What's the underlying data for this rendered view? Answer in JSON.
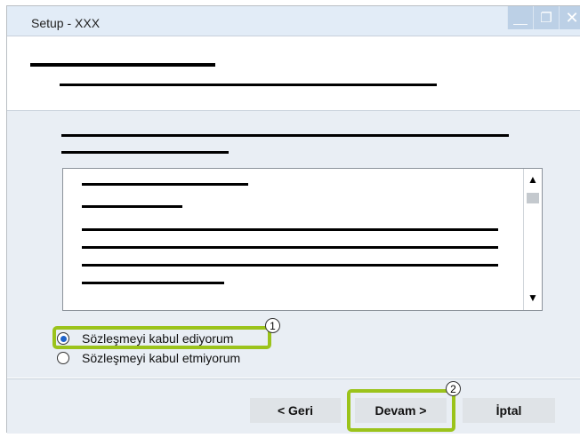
{
  "window": {
    "title": "Setup - XXX",
    "controls": {
      "minimize": "__",
      "restore": "❐",
      "close": "✕"
    }
  },
  "license": {
    "scroll_up": "▲",
    "scroll_down": "▼",
    "options": [
      {
        "label": "Sözleşmeyi kabul ediyorum",
        "selected": true
      },
      {
        "label": "Sözleşmeyi kabul etmiyorum",
        "selected": false
      }
    ]
  },
  "callouts": {
    "accept": "1",
    "next": "2"
  },
  "footer": {
    "back_label": "< Geri",
    "next_label": "Devam >",
    "cancel_label": "İptal"
  },
  "colors": {
    "highlight": "#9bc31b",
    "radio_selected": "#1f63c9",
    "titlebar": "#e2ecf7"
  }
}
